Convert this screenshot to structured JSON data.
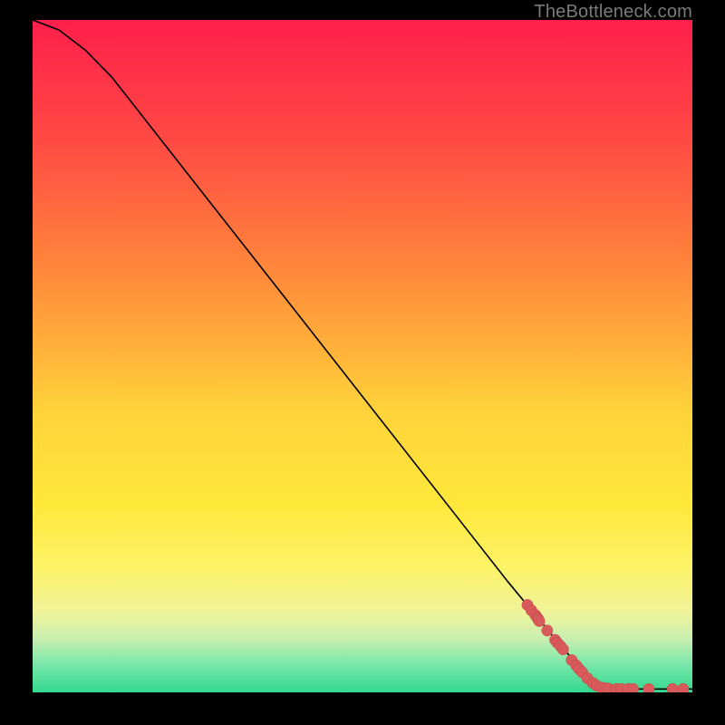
{
  "watermark": "TheBottleneck.com",
  "colors": {
    "curve": "#000000",
    "points": "#d85a5a",
    "points_stroke": "#c44848"
  },
  "chart_data": {
    "type": "line",
    "title": "",
    "xlabel": "",
    "ylabel": "",
    "xlim": [
      0,
      100
    ],
    "ylim": [
      0,
      100
    ],
    "curve": [
      {
        "x": 0,
        "y": 100
      },
      {
        "x": 4,
        "y": 98.5
      },
      {
        "x": 8,
        "y": 95.5
      },
      {
        "x": 12,
        "y": 91.5
      },
      {
        "x": 16,
        "y": 86.5
      },
      {
        "x": 24,
        "y": 76.5
      },
      {
        "x": 36,
        "y": 61.5
      },
      {
        "x": 48,
        "y": 46.5
      },
      {
        "x": 60,
        "y": 31.5
      },
      {
        "x": 72,
        "y": 16.5
      },
      {
        "x": 80,
        "y": 7
      },
      {
        "x": 84,
        "y": 2.5
      },
      {
        "x": 86,
        "y": 1
      },
      {
        "x": 88,
        "y": 0.5
      },
      {
        "x": 100,
        "y": 0.5
      }
    ],
    "points": [
      {
        "x": 75.0,
        "y": 13.0
      },
      {
        "x": 75.6,
        "y": 12.2
      },
      {
        "x": 76.2,
        "y": 11.5
      },
      {
        "x": 76.5,
        "y": 11.1
      },
      {
        "x": 76.6,
        "y": 10.9
      },
      {
        "x": 76.8,
        "y": 10.6
      },
      {
        "x": 78.0,
        "y": 9.2
      },
      {
        "x": 79.2,
        "y": 7.8
      },
      {
        "x": 79.5,
        "y": 7.4
      },
      {
        "x": 80.0,
        "y": 6.9
      },
      {
        "x": 80.4,
        "y": 6.4
      },
      {
        "x": 81.7,
        "y": 4.8
      },
      {
        "x": 82.4,
        "y": 4.0
      },
      {
        "x": 82.8,
        "y": 3.5
      },
      {
        "x": 83.3,
        "y": 3.0
      },
      {
        "x": 84.1,
        "y": 2.1
      },
      {
        "x": 84.9,
        "y": 1.4
      },
      {
        "x": 85.5,
        "y": 1.0
      },
      {
        "x": 86.2,
        "y": 0.7
      },
      {
        "x": 86.8,
        "y": 0.6
      },
      {
        "x": 87.3,
        "y": 0.55
      },
      {
        "x": 88.5,
        "y": 0.5
      },
      {
        "x": 89.2,
        "y": 0.5
      },
      {
        "x": 90.3,
        "y": 0.5
      },
      {
        "x": 91.0,
        "y": 0.5
      },
      {
        "x": 93.4,
        "y": 0.5
      },
      {
        "x": 97.0,
        "y": 0.5
      },
      {
        "x": 98.6,
        "y": 0.5
      }
    ]
  }
}
